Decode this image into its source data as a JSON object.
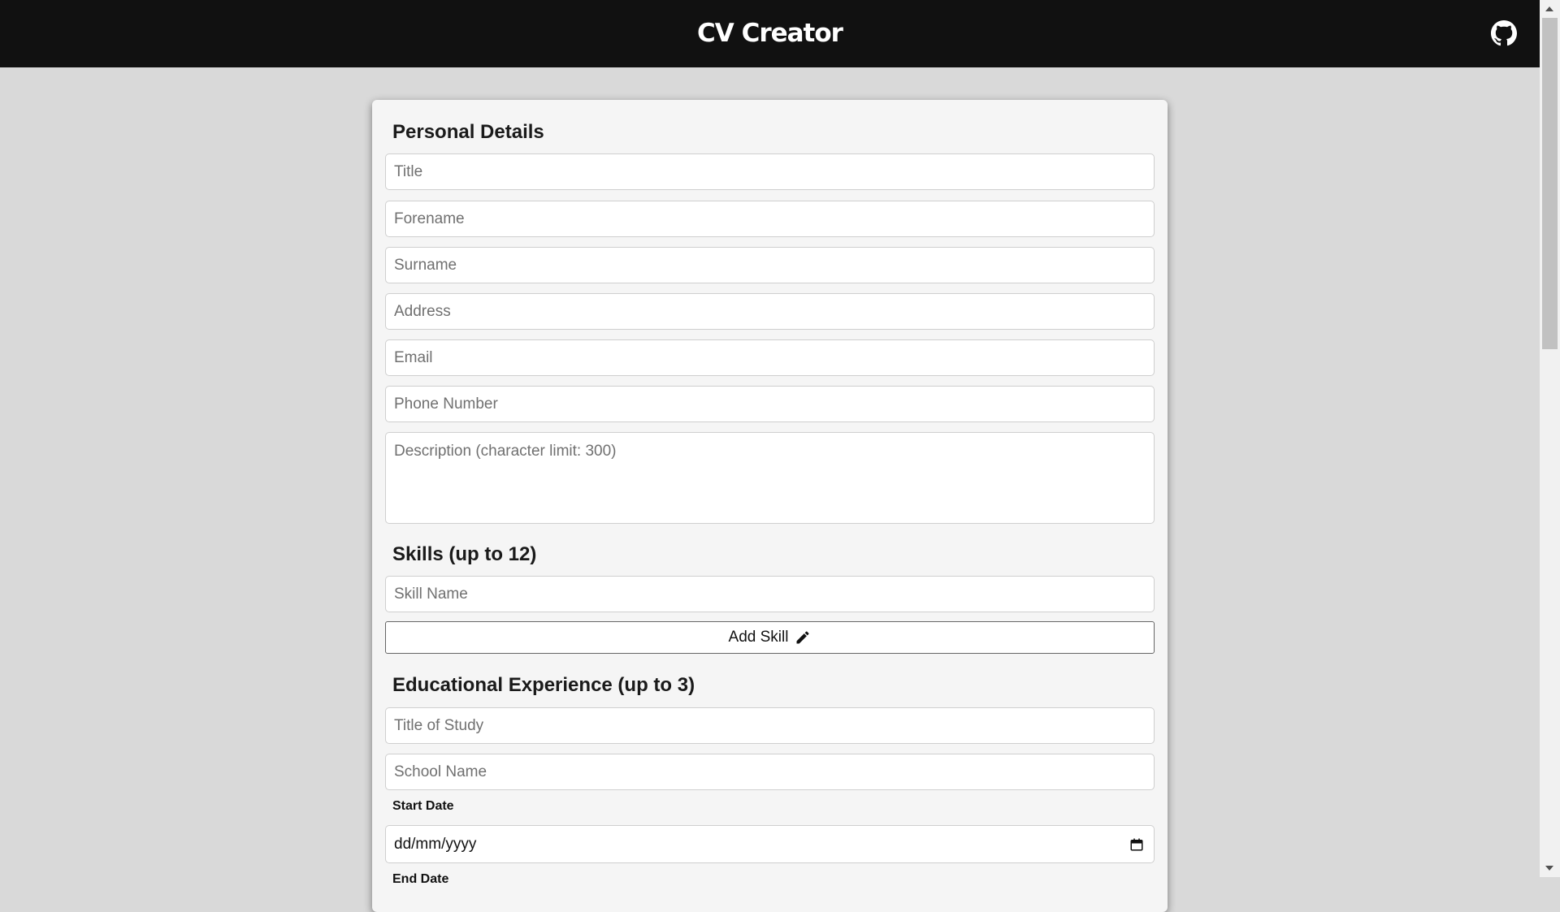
{
  "header": {
    "title": "CV Creator",
    "github_icon": "github-icon"
  },
  "personal": {
    "heading": "Personal Details",
    "title_placeholder": "Title",
    "forename_placeholder": "Forename",
    "surname_placeholder": "Surname",
    "address_placeholder": "Address",
    "email_placeholder": "Email",
    "phone_placeholder": "Phone Number",
    "description_placeholder": "Description (character limit: 300)"
  },
  "skills": {
    "heading": "Skills (up to 12)",
    "skill_placeholder": "Skill Name",
    "add_label": "Add Skill",
    "add_icon": "pencil-icon"
  },
  "education": {
    "heading": "Educational Experience (up to 3)",
    "study_placeholder": "Title of Study",
    "school_placeholder": "School Name",
    "start_label": "Start Date",
    "start_value": "dd/mm/yyyy",
    "end_label": "End Date",
    "calendar_icon": "calendar-icon"
  },
  "colors": {
    "header_bg": "#111111",
    "page_bg": "#d9d9d9",
    "card_bg": "#f5f5f5"
  }
}
